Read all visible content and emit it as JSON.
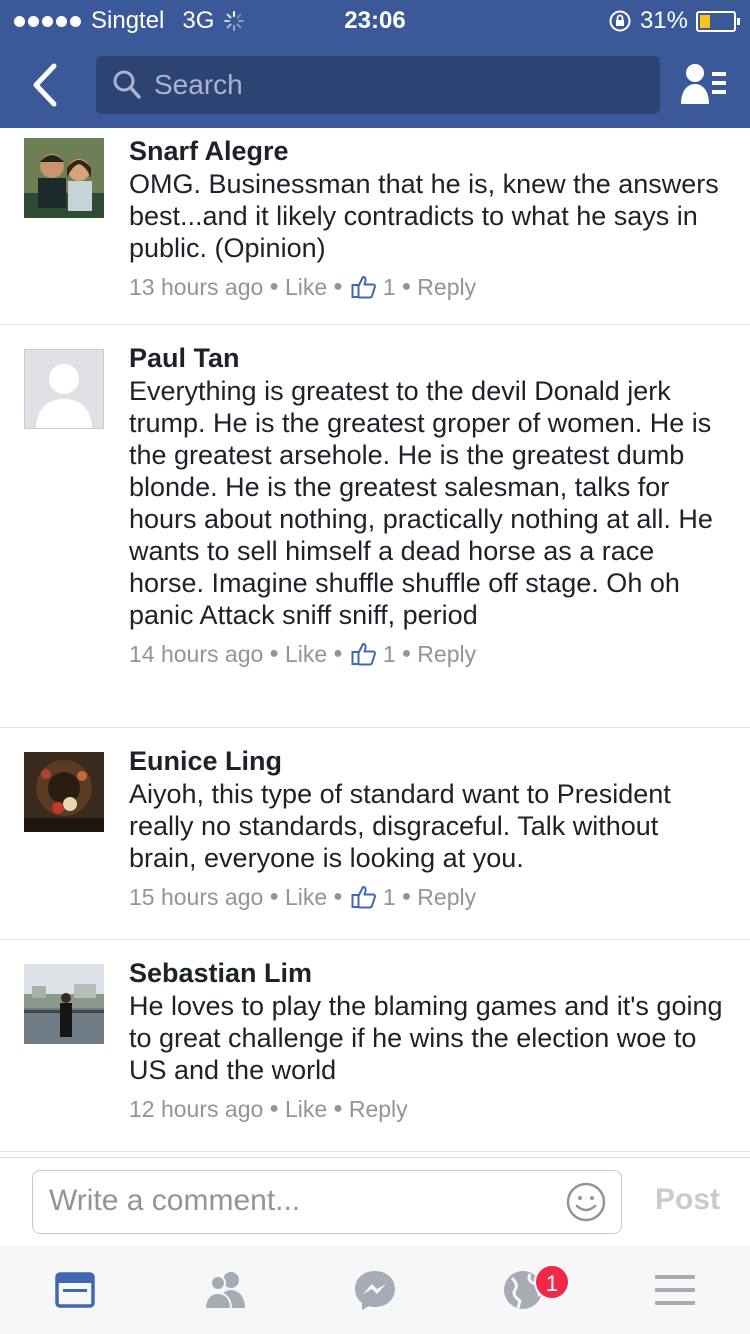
{
  "status_bar": {
    "carrier": "Singtel",
    "network": "3G",
    "time": "23:06",
    "battery": "31%",
    "battery_level": 0.31
  },
  "nav": {
    "search_placeholder": "Search"
  },
  "comments": [
    {
      "name": "Snarf Alegre",
      "text": "OMG. Businessman that he is, knew the answers best...and it likely contradicts to what he says in public. (Opinion)",
      "time": "13 hours ago",
      "like_label": "Like",
      "like_count": "1",
      "reply_label": "Reply"
    },
    {
      "name": "Paul Tan",
      "text": "Everything is greatest to the devil Donald jerk trump. He is the greatest groper of women. He is the greatest arsehole. He is the greatest dumb blonde. He is the greatest salesman, talks for hours about nothing, practically nothing at all. He wants to sell himself a dead horse as a race horse. Imagine shuffle shuffle off stage. Oh oh panic Attack sniff sniff, period",
      "time": "14 hours ago",
      "like_label": "Like",
      "like_count": "1",
      "reply_label": "Reply"
    },
    {
      "name": "Eunice Ling",
      "text": "Aiyoh, this type of standard want to President really no standards, disgraceful. Talk without brain, everyone is looking at you.",
      "time": "15 hours ago",
      "like_label": "Like",
      "like_count": "1",
      "reply_label": "Reply"
    },
    {
      "name": "Sebastian Lim",
      "text": "He loves to play the blaming games and it's going to great challenge if he wins the election woe to US and the world",
      "time": "12 hours ago",
      "like_label": "Like",
      "reply_label": "Reply"
    }
  ],
  "composer": {
    "placeholder": "Write a comment...",
    "post_label": "Post"
  },
  "tabbar": {
    "notifications_count": "1"
  },
  "colors": {
    "brand": "#3b5998",
    "accent": "#4267b2",
    "badge": "#f02849"
  },
  "icons": [
    "back-chevron-icon",
    "search-icon",
    "friend-requests-icon",
    "like-thumb-icon",
    "smiley-icon",
    "news-feed-icon",
    "friends-icon",
    "messenger-icon",
    "globe-icon",
    "menu-icon"
  ]
}
